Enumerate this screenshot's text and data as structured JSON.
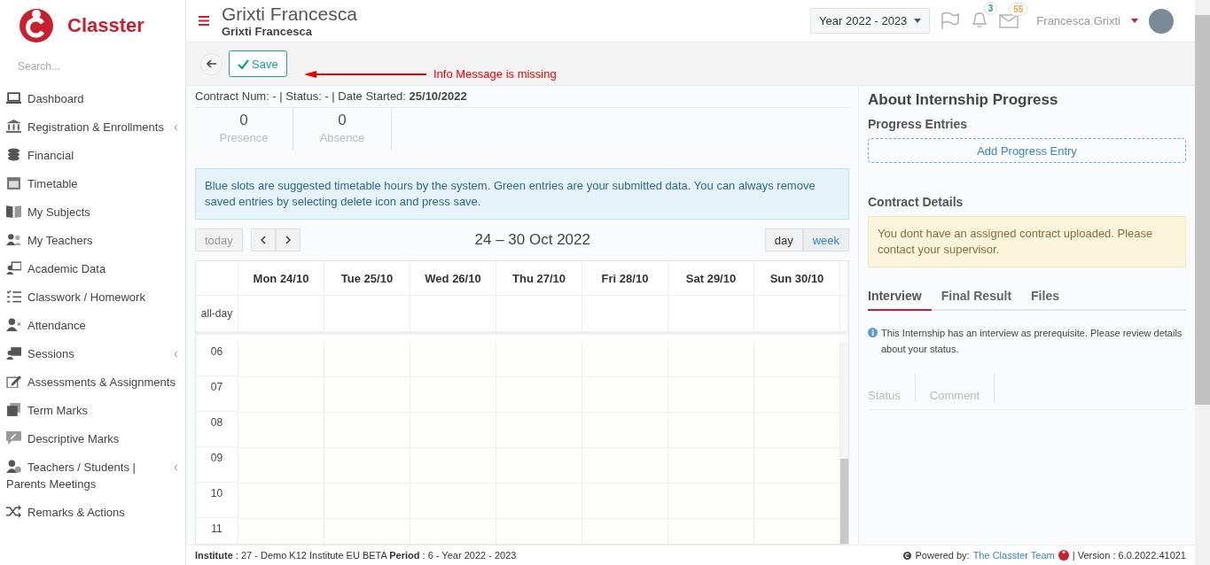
{
  "sidebar": {
    "logo_text": "Classter",
    "search": {
      "placeholder": "Search..."
    },
    "items": [
      {
        "label": "Dashboard",
        "expandable": false
      },
      {
        "label": "Registration & Enrollments",
        "expandable": true
      },
      {
        "label": "Financial",
        "expandable": false
      },
      {
        "label": "Timetable",
        "expandable": false
      },
      {
        "label": "My Subjects",
        "expandable": false
      },
      {
        "label": "My Teachers",
        "expandable": false
      },
      {
        "label": "Academic Data",
        "expandable": false
      },
      {
        "label": "Classwork / Homework",
        "expandable": false
      },
      {
        "label": "Attendance",
        "expandable": false
      },
      {
        "label": "Sessions",
        "expandable": true
      },
      {
        "label": "Assessments & Assignments",
        "expandable": false
      },
      {
        "label": "Term Marks",
        "expandable": false
      },
      {
        "label": "Descriptive Marks",
        "expandable": false
      },
      {
        "label": "Teachers / Students | Parents Meetings",
        "expandable": true
      },
      {
        "label": "Remarks & Actions",
        "expandable": false
      }
    ]
  },
  "header": {
    "title": "Grixti Francesca",
    "subtitle": "Grixti Francesca",
    "year": "Year 2022 - 2023",
    "notifications": "3",
    "messages": "55",
    "user": "Francesca Grixti"
  },
  "toolbar": {
    "save": "Save",
    "annotation": "Info Message is missing"
  },
  "contract_line": "Contract Num: -   | Status: - | Date Started: **25/10/2022**",
  "stats": [
    {
      "value": "0",
      "label": "Presence"
    },
    {
      "value": "0",
      "label": "Absence"
    }
  ],
  "info": "Blue slots are suggested timetable hours by the system. Green entries are your submitted data. You can always remove saved entries by selecting delete icon and press save.",
  "calendar": {
    "today": "today",
    "title": "24 – 30 Oct 2022",
    "views": [
      {
        "label": "day",
        "selected": false
      },
      {
        "label": "week",
        "selected": true
      }
    ],
    "days": [
      "Mon 24/10",
      "Tue 25/10",
      "Wed 26/10",
      "Thu 27/10",
      "Fri 28/10",
      "Sat 29/10",
      "Sun 30/10"
    ],
    "allday": "all-day",
    "hours": [
      "06",
      "07",
      "08",
      "09",
      "10",
      "11"
    ]
  },
  "right": {
    "title": "About Internship Progress",
    "progress_heading": "Progress Entries",
    "add_button": "Add Progress Entry",
    "contract_heading": "Contract Details",
    "contract_warning": "You dont have an assigned contract uploaded. Please contact your supervisor.",
    "tabs": [
      {
        "label": "Interview",
        "selected": true
      },
      {
        "label": "Final Result",
        "selected": false
      },
      {
        "label": "Files",
        "selected": false
      }
    ],
    "interview_info": "This Internship has an interview as prerequisite. Please review details about your status.",
    "columns": [
      "Status",
      "Comment"
    ]
  },
  "footer": {
    "left": "**Institute** : 27 - Demo K12 Institute EU BETA **Period** : 6 - Year 2022 - 2023",
    "powered": "Powered by:",
    "team": "The Classter Team",
    "version": "| Version : 6.0.2022.41021"
  }
}
